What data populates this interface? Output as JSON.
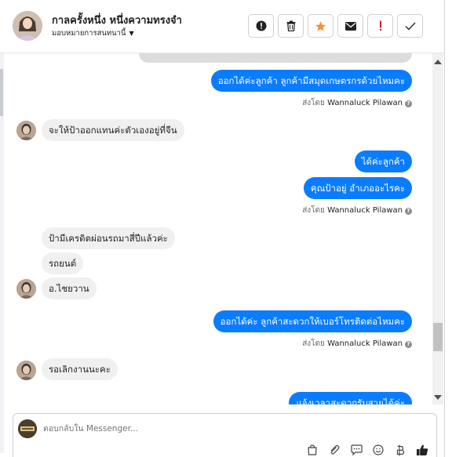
{
  "header": {
    "title": "กาลครั้งหนึ่ง หนึ่งความทรงจำ",
    "assign_label": "มอบหมายการสนทนานี้",
    "toolbar": [
      {
        "name": "mark-spam-button",
        "icon": "exclamation-circle-icon"
      },
      {
        "name": "delete-button",
        "icon": "trash-icon"
      },
      {
        "name": "star-button",
        "icon": "star-icon",
        "color": "#f7923a"
      },
      {
        "name": "mark-unread-button",
        "icon": "envelope-icon"
      },
      {
        "name": "follow-up-button",
        "icon": "exclamation-icon",
        "color": "#e02020"
      },
      {
        "name": "mark-done-button",
        "icon": "check-icon"
      }
    ]
  },
  "messages": [
    {
      "dir": "out",
      "text": "ออกได้ค่ะลูกค้า  ลูกค้ามีสมุดเกษตรกรด้วยไหมคะ"
    },
    {
      "dir": "meta",
      "prefix": "ส่งโดย",
      "name": "Wannaluck Pilawan"
    },
    {
      "dir": "in",
      "text": "จะให้ป้าออกแทนค่ะตัวเองอยู่ที่จีน"
    },
    {
      "dir": "out",
      "text": "ได้ค่ะลูกค้า"
    },
    {
      "dir": "out",
      "text": "คุณป้าอยู่ อำเภออะไรคะ"
    },
    {
      "dir": "meta",
      "prefix": "ส่งโดย",
      "name": "Wannaluck Pilawan"
    },
    {
      "dir": "in",
      "text": "ป้ามีเครดิตผ่อนรถมาสี่ปีแล้วค่ะ"
    },
    {
      "dir": "in",
      "text": "รถยนต์"
    },
    {
      "dir": "in",
      "text": "อ.ไชยวาน"
    },
    {
      "dir": "out",
      "text": "ออกได้ค่ะ  ลูกค้าสะดวกให้เบอร์โทรติดต่อไหมคะ"
    },
    {
      "dir": "meta",
      "prefix": "ส่งโดย",
      "name": "Wannaluck Pilawan"
    },
    {
      "dir": "in",
      "text": "รอเลิกงานนะคะ"
    },
    {
      "dir": "out",
      "text": "แจ้งเวลาสะดวกรับสายได้ค่ะ"
    }
  ],
  "composer": {
    "placeholder": "ตอบกลับใน Messenger...",
    "icons": [
      "bag-icon",
      "paperclip-icon",
      "chat-bubble-icon",
      "emoji-icon",
      "baht-icon",
      "thumbs-up-icon"
    ]
  },
  "colors": {
    "outgoing": "#0a7cff",
    "incoming": "#f0f0f0"
  }
}
